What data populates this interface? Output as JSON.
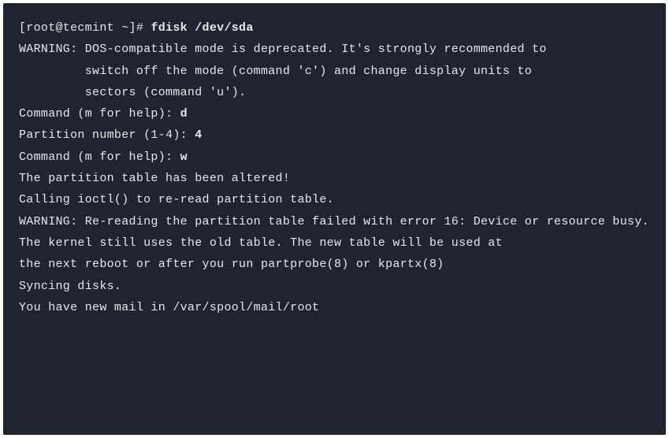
{
  "prompt": "[root@tecmint ~]# ",
  "command": "fdisk /dev/sda",
  "blank": "",
  "warn1_l1": "WARNING: DOS-compatible mode is deprecated. It's strongly recommended to",
  "warn1_l2": "         switch off the mode (command 'c') and change display units to",
  "warn1_l3": "         sectors (command 'u').",
  "cmd1_prompt": "Command (m for help): ",
  "cmd1_input": "d",
  "partnum_prompt": "Partition number (1-4): ",
  "partnum_input": "4",
  "cmd2_prompt": "Command (m for help): ",
  "cmd2_input": "w",
  "altered": "The partition table has been altered!",
  "ioctl": "Calling ioctl() to re-read partition table.",
  "warn2_l1": "WARNING: Re-reading the partition table failed with error 16: Device or resource busy.",
  "warn2_l2": "The kernel still uses the old table. The new table will be used at",
  "warn2_l3": "the next reboot or after you run partprobe(8) or kpartx(8)",
  "syncing": "Syncing disks.",
  "mail": "You have new mail in /var/spool/mail/root"
}
